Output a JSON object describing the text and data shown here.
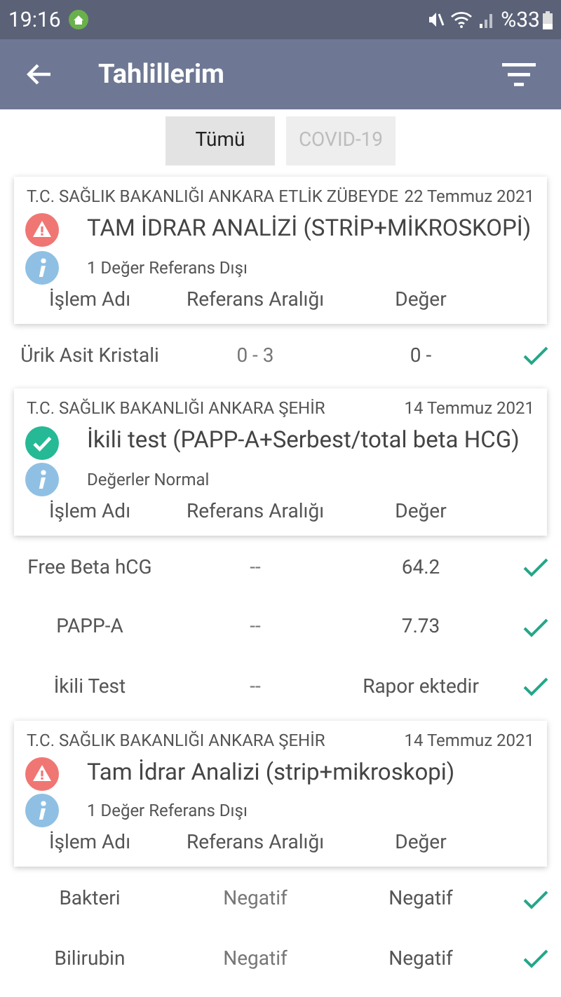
{
  "status_bar": {
    "time": "19:16",
    "battery": "%33"
  },
  "app_bar": {
    "title": "Tahlillerim"
  },
  "tabs": [
    {
      "label": "Tümü",
      "selected": true
    },
    {
      "label": "COVID-19",
      "selected": false
    }
  ],
  "results": [
    {
      "hospital": "T.C. SAĞLIK BAKANLIĞI ANKARA ETLİK ZÜBEYDE",
      "date": "22 Temmuz 2021",
      "title": "TAM İDRAR ANALİZİ (STRİP+MİKROSKOPİ)",
      "out_of_range": true,
      "summary": "1 Değer Referans Dışı",
      "columns": [
        "İşlem Adı",
        "Referans Aralığı",
        "Değer"
      ],
      "rows": [
        {
          "name": "Ürik Asit Kristali",
          "range": "0 - 3",
          "value": "0 -",
          "ok": true
        }
      ]
    },
    {
      "hospital": "T.C. SAĞLIK BAKANLIĞI ANKARA ŞEHİR",
      "date": "14 Temmuz 2021",
      "title": "İkili test (PAPP-A+Serbest/total beta HCG)",
      "out_of_range": false,
      "summary": "Değerler Normal",
      "columns": [
        "İşlem Adı",
        "Referans Aralığı",
        "Değer"
      ],
      "rows": [
        {
          "name": "Free Beta hCG",
          "range": "--",
          "value": "64.2",
          "ok": true
        },
        {
          "name": "PAPP-A",
          "range": "--",
          "value": "7.73",
          "ok": true
        },
        {
          "name": "İkili Test",
          "range": "--",
          "value": "Rapor ektedir",
          "ok": true
        }
      ]
    },
    {
      "hospital": "T.C. SAĞLIK BAKANLIĞI ANKARA ŞEHİR",
      "date": "14 Temmuz 2021",
      "title": "Tam İdrar Analizi (strip+mikroskopi)",
      "out_of_range": true,
      "summary": "1 Değer Referans Dışı",
      "columns": [
        "İşlem Adı",
        "Referans Aralığı",
        "Değer"
      ],
      "rows": [
        {
          "name": "Bakteri",
          "range": "Negatif",
          "value": "Negatif",
          "ok": true
        },
        {
          "name": "Bilirubin",
          "range": "Negatif",
          "value": "Negatif",
          "ok": true
        }
      ]
    }
  ]
}
